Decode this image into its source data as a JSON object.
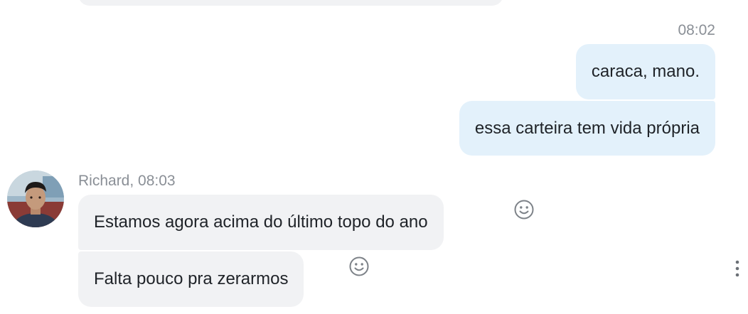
{
  "thread": {
    "outgoing_time": "08:02",
    "outgoing": [
      {
        "text": "caraca, mano."
      },
      {
        "text": "essa carteira tem vida própria"
      }
    ],
    "incoming_sender": "Richard, 08:03",
    "incoming": [
      {
        "text": "Estamos agora acima do último topo do ano"
      },
      {
        "text": "Falta pouco pra zerarmos"
      }
    ]
  },
  "icons": {
    "reaction": "smiley-icon",
    "more": "more-vertical-icon",
    "avatar": "richard-avatar"
  },
  "colors": {
    "outgoing_bubble": "#e3f1fb",
    "incoming_bubble": "#f1f2f4",
    "meta_text": "#8a8f96"
  }
}
